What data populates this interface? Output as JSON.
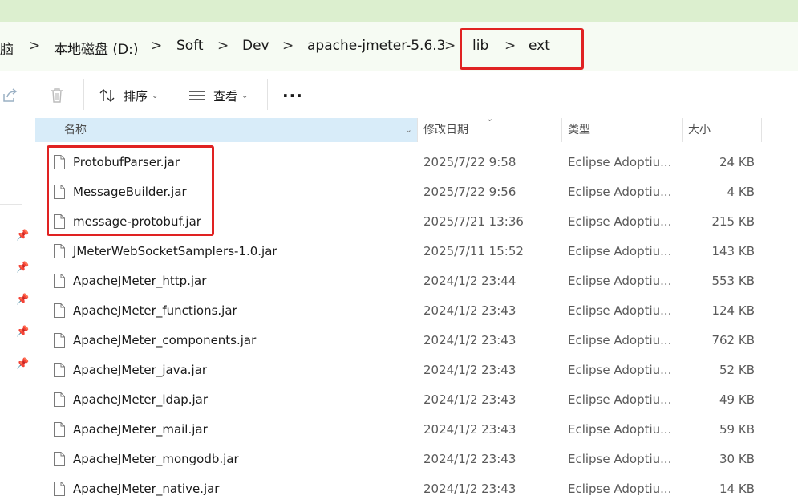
{
  "colors": {
    "accent": "#d8ecf9",
    "highlight_box": "#e02222",
    "address_bg": "#f6fbf3"
  },
  "breadcrumb": {
    "items": [
      "脑",
      "本地磁盘 (D:)",
      "Soft",
      "Dev",
      "apache-jmeter-5.6.3",
      "lib",
      "ext"
    ],
    "separator": ">"
  },
  "toolbar": {
    "share_icon": "share-icon",
    "delete_icon": "trash-icon",
    "sort_label": "排序",
    "view_label": "查看",
    "more_label": "···"
  },
  "columns": {
    "name": "名称",
    "date": "修改日期",
    "type": "类型",
    "size": "大小"
  },
  "files": [
    {
      "name": "ProtobufParser.jar",
      "date": "2025/7/22 9:58",
      "type": "Eclipse Adoptiu...",
      "size": "24 KB"
    },
    {
      "name": "MessageBuilder.jar",
      "date": "2025/7/22 9:56",
      "type": "Eclipse Adoptiu...",
      "size": "4 KB"
    },
    {
      "name": "message-protobuf.jar",
      "date": "2025/7/21 13:36",
      "type": "Eclipse Adoptiu...",
      "size": "215 KB"
    },
    {
      "name": "JMeterWebSocketSamplers-1.0.jar",
      "date": "2025/7/11 15:52",
      "type": "Eclipse Adoptiu...",
      "size": "143 KB"
    },
    {
      "name": "ApacheJMeter_http.jar",
      "date": "2024/1/2 23:44",
      "type": "Eclipse Adoptiu...",
      "size": "553 KB"
    },
    {
      "name": "ApacheJMeter_functions.jar",
      "date": "2024/1/2 23:43",
      "type": "Eclipse Adoptiu...",
      "size": "124 KB"
    },
    {
      "name": "ApacheJMeter_components.jar",
      "date": "2024/1/2 23:43",
      "type": "Eclipse Adoptiu...",
      "size": "762 KB"
    },
    {
      "name": "ApacheJMeter_java.jar",
      "date": "2024/1/2 23:43",
      "type": "Eclipse Adoptiu...",
      "size": "52 KB"
    },
    {
      "name": "ApacheJMeter_ldap.jar",
      "date": "2024/1/2 23:43",
      "type": "Eclipse Adoptiu...",
      "size": "49 KB"
    },
    {
      "name": "ApacheJMeter_mail.jar",
      "date": "2024/1/2 23:43",
      "type": "Eclipse Adoptiu...",
      "size": "59 KB"
    },
    {
      "name": "ApacheJMeter_mongodb.jar",
      "date": "2024/1/2 23:43",
      "type": "Eclipse Adoptiu...",
      "size": "30 KB"
    },
    {
      "name": "ApacheJMeter_native.jar",
      "date": "2024/1/2 23:43",
      "type": "Eclipse Adoptiu...",
      "size": "14 KB"
    }
  ]
}
